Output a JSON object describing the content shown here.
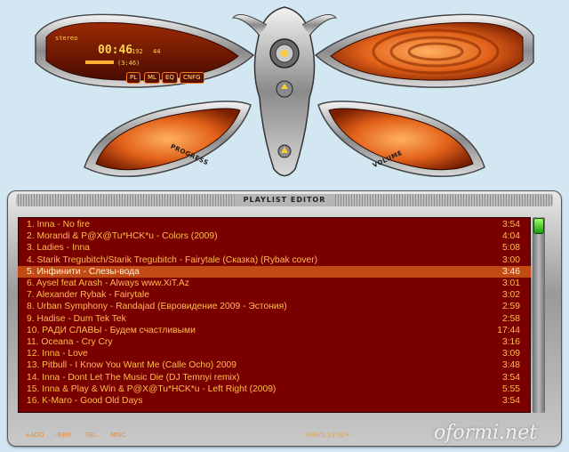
{
  "player": {
    "time": "00:46",
    "kbps": "192",
    "khz": "44",
    "mode": "stereo",
    "song_info": "(3:46)",
    "buttons": [
      "PL",
      "ML",
      "EQ",
      "CNFG"
    ],
    "progress_label": "PROGRESS",
    "volume_label": "VOLUME",
    "accent_color": "#e2621a",
    "lcd_color": "#ffd24a"
  },
  "playlist": {
    "title": "PLAYLIST EDITOR",
    "selected_index": 4,
    "items": [
      {
        "label": "1. Inna - No fire",
        "duration": "3:54"
      },
      {
        "label": "2. Morandi & P@X@Tu*HCK*u - Colors (2009)",
        "duration": "4:04"
      },
      {
        "label": "3. Ladies - Inna",
        "duration": "5:08"
      },
      {
        "label": "4. Starik Tregubitch/Starik Tregubitch - Fairytale (Сказка) (Rybak cover)",
        "duration": "3:00"
      },
      {
        "label": "5. Инфинити - Слезы-вода",
        "duration": "3:46"
      },
      {
        "label": "6. Aysel feat Arash - Always  www.XiT.Az",
        "duration": "3:01"
      },
      {
        "label": "7. Alexander Rybak - Fairytale",
        "duration": "3:02"
      },
      {
        "label": "8. Urban Symphony - Randajad (Евровидение 2009 - Эстония)",
        "duration": "2:59"
      },
      {
        "label": "9. Hadise - Dum Tek Tek",
        "duration": "2:58"
      },
      {
        "label": "10. РАДИ СЛАВЫ - Будем счастливыми",
        "duration": "17:44"
      },
      {
        "label": "11. Oceana - Cry Cry",
        "duration": "3:16"
      },
      {
        "label": "12. Inna - Love",
        "duration": "3:09"
      },
      {
        "label": "13. Pitbull - I Know You Want Me (Calle Ocho) 2009",
        "duration": "3:48"
      },
      {
        "label": "14. Inna - Dont Let The Music Die (DJ Temnyi remix)",
        "duration": "3:54"
      },
      {
        "label": "15. Inna & Play & Win & P@X@Tu*HCK*u - Left Right (2009)",
        "duration": "5:55"
      },
      {
        "label": "16. K-Maro - Good Old Days",
        "duration": "3:54"
      }
    ],
    "footer": {
      "add": "+ADD",
      "rem": "-REM",
      "sel": "SEL",
      "misc": "MISC",
      "total_time": "3:46/1:13:32+"
    },
    "selection_color": "#c24a14",
    "list_bg": "#7a0000",
    "text_color": "#ffbf4a"
  },
  "watermark": "oformi.net"
}
